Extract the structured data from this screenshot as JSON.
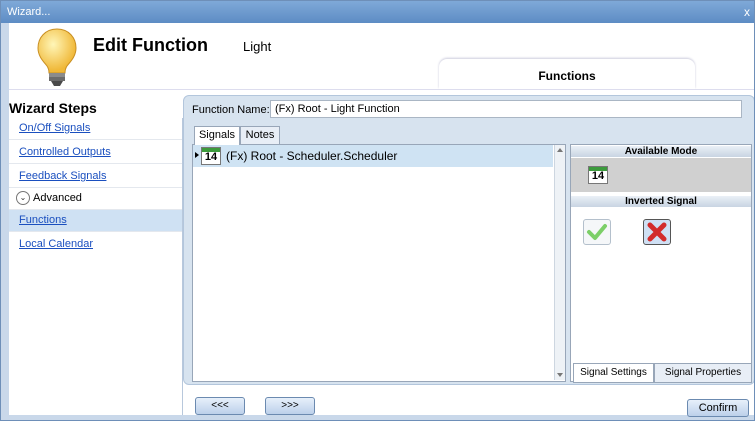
{
  "window": {
    "title": "Wizard...",
    "close_glyph": "x"
  },
  "header": {
    "title": "Edit Function",
    "subtitle": "Light",
    "tab_label": "Functions"
  },
  "wizard": {
    "title": "Wizard Steps",
    "steps": [
      {
        "label": "On/Off Signals"
      },
      {
        "label": "Controlled Outputs"
      },
      {
        "label": "Feedback Signals"
      },
      {
        "label": "Advanced"
      },
      {
        "label": "Functions"
      },
      {
        "label": "Local Calendar"
      }
    ]
  },
  "form": {
    "function_name_label": "Function Name:",
    "function_name_value": "(Fx) Root - Light Function"
  },
  "tabs": [
    {
      "label": "Signals"
    },
    {
      "label": "Notes"
    }
  ],
  "signals": [
    {
      "label": "(Fx) Root - Scheduler.Scheduler",
      "icon_number": "14"
    }
  ],
  "right_panel": {
    "available_mode_header": "Available Mode",
    "mode_icon_number": "14",
    "inverted_signal_header": "Inverted Signal",
    "bottom_tabs": [
      {
        "label": "Signal Settings"
      },
      {
        "label": "Signal Properties"
      }
    ]
  },
  "footer": {
    "prev_label": "<<<",
    "next_label": ">>>",
    "confirm_label": "Confirm"
  },
  "colors": {
    "title_bar": "#5d8cc4",
    "selected_row": "#cfe3f3",
    "link": "#1a4fbf"
  }
}
